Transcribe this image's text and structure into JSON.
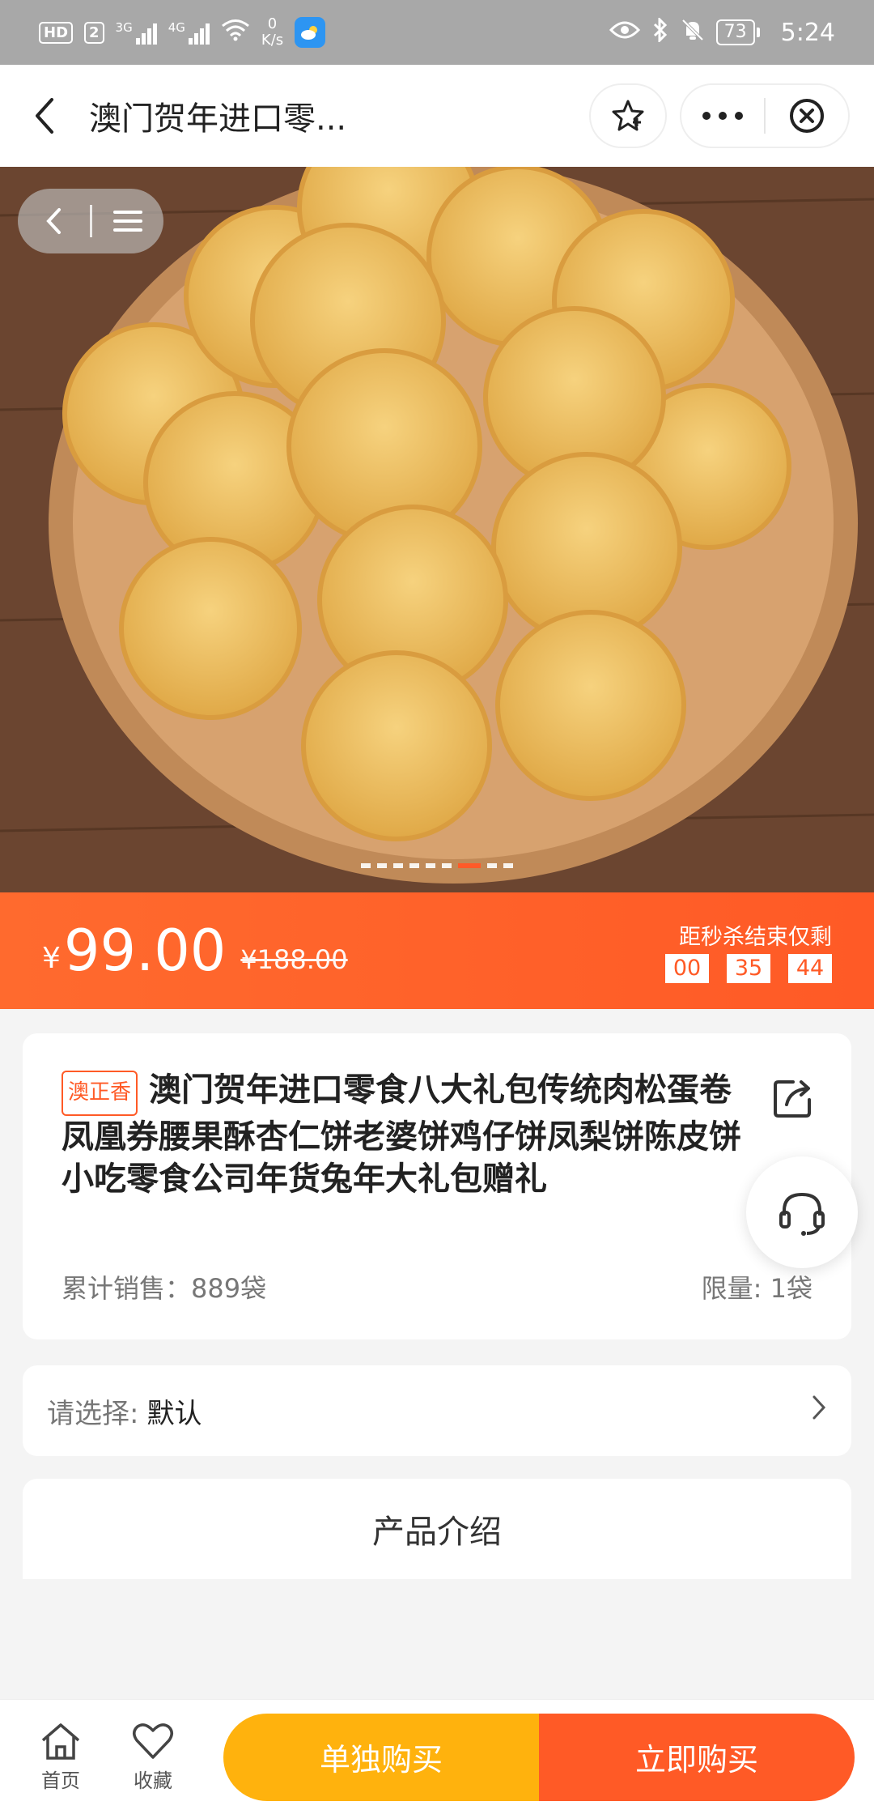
{
  "status_bar": {
    "hd_label": "HD",
    "sim_label": "2",
    "signal1_label": "3G",
    "signal2_label": "4G",
    "net_speed_value": "0",
    "net_speed_unit": "K/s",
    "battery": "73",
    "time": "5:24"
  },
  "header": {
    "title": "澳门贺年进口零..."
  },
  "hero": {
    "slide_count": 9,
    "active_slide": 6
  },
  "price": {
    "currency": "¥",
    "current": "99.00",
    "original": "¥188.00",
    "countdown_label": "距秒杀结束仅剩",
    "hours": "00",
    "minutes": "35",
    "seconds": "44"
  },
  "product": {
    "brand_tag": "澳正香",
    "title": "澳门贺年进口零食八大礼包传统肉松蛋卷凤凰券腰果酥杏仁饼老婆饼鸡仔饼凤梨饼陈皮饼小吃零食公司年货兔年大礼包赠礼",
    "sales": "累计销售：889袋",
    "limit": "限量: 1袋"
  },
  "option": {
    "label": "请选择:",
    "value": "默认"
  },
  "intro": {
    "title": "产品介绍"
  },
  "bottom_bar": {
    "home": "首页",
    "favorite": "收藏",
    "buy_single": "单独购买",
    "buy_now": "立即购买"
  },
  "colors": {
    "accent": "#ff5a26",
    "secondary": "#ffb20d"
  }
}
